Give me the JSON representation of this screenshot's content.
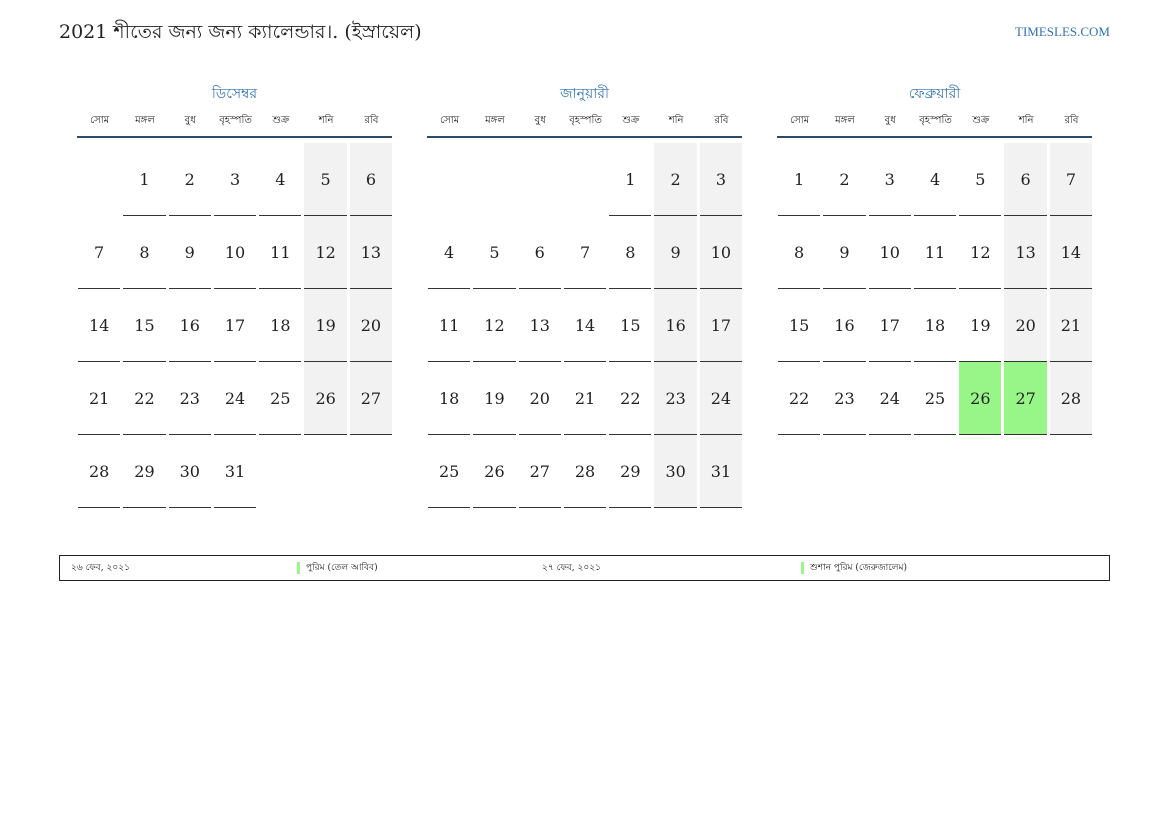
{
  "header": {
    "title": "2021 শীতের জন্য জন্য ক্যালেন্ডার।. (ইস্রায়েল)",
    "site": "TIMESLES.COM"
  },
  "weekdays": [
    "সোম",
    "মঙ্গল",
    "বুধ",
    "বৃহস্পতি",
    "শুক্র",
    "শনি",
    "রবি"
  ],
  "months": [
    {
      "name": "ডিসেম্বর",
      "offset": 1,
      "days": 31,
      "holidays": []
    },
    {
      "name": "জানুয়ারী",
      "offset": 4,
      "days": 31,
      "holidays": []
    },
    {
      "name": "ফেব্রুয়ারী",
      "offset": 0,
      "days": 28,
      "holidays": [
        26,
        27
      ]
    }
  ],
  "legend": [
    {
      "date": "২৬ ফেব, ২০২১",
      "event": "পুরিম (তেল আবিব)"
    },
    {
      "date": "২৭ ফেব, ২০২১",
      "event": "শুশান পুরিম (জেরুজালেম)"
    }
  ],
  "colors": {
    "accent": "#2f73b0",
    "holiday": "#98f587",
    "weekend": "#f2f2f2"
  }
}
